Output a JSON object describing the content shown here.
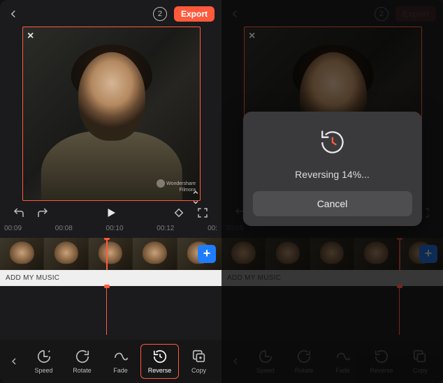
{
  "colors": {
    "accent": "#ff5a3c",
    "add_btn": "#1e7dff"
  },
  "header": {
    "export_label": "Export",
    "badge_value": "2"
  },
  "preview": {
    "close_label": "×",
    "watermark_line1": "Wondershare",
    "watermark_line2": "Filmora"
  },
  "controls": {
    "times": [
      "00:09",
      "00:08",
      "00:10",
      "00:12",
      "00:"
    ]
  },
  "timeline": {
    "add_label": "+"
  },
  "music_bar": {
    "label": "ADD MY MUSIC"
  },
  "toolbar": {
    "items": [
      {
        "label": "Speed"
      },
      {
        "label": "Rotate"
      },
      {
        "label": "Fade"
      },
      {
        "label": "Reverse"
      },
      {
        "label": "Copy"
      }
    ]
  },
  "modal": {
    "status_prefix": "Reversing ",
    "percent": "14%",
    "status_suffix": "...",
    "cancel_label": "Cancel"
  }
}
